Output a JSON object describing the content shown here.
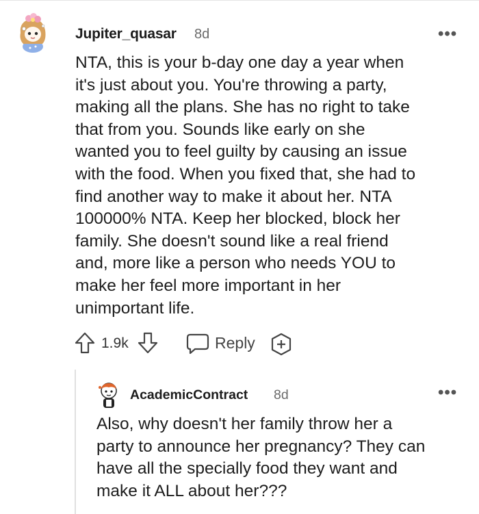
{
  "comment": {
    "author": "Jupiter_quasar",
    "age": "8d",
    "more": "•••",
    "lines": [
      "NTA, this is your b-day one day a year when",
      "it's just about you. You're throwing a party,",
      "making all the plans. She has no right to take",
      "that from you. Sounds like early on she",
      "wanted you to feel guilty by causing an issue",
      "with the food. When you fixed that, she had to",
      "find another way to make it about her. NTA",
      "100000% NTA. Keep her blocked, block her",
      "family. She doesn't sound like a real friend",
      "and, more like a person who needs YOU to",
      "make her feel more important in her",
      "unimportant life."
    ],
    "vote_count": "1.9k",
    "reply_label": "Reply",
    "icons": {
      "upvote": "upvote-arrow-icon",
      "downvote": "downvote-arrow-icon",
      "reply": "speech-bubble-icon",
      "award": "add-award-icon",
      "more": "more-options-icon"
    }
  },
  "reply": {
    "author": "AcademicContract",
    "age": "8d",
    "more": "•••",
    "lines": [
      "Also, why doesn't her family throw her a",
      "party to announce her pregnancy? They can",
      "have all the specially food they want and",
      "make it ALL about her???"
    ]
  }
}
